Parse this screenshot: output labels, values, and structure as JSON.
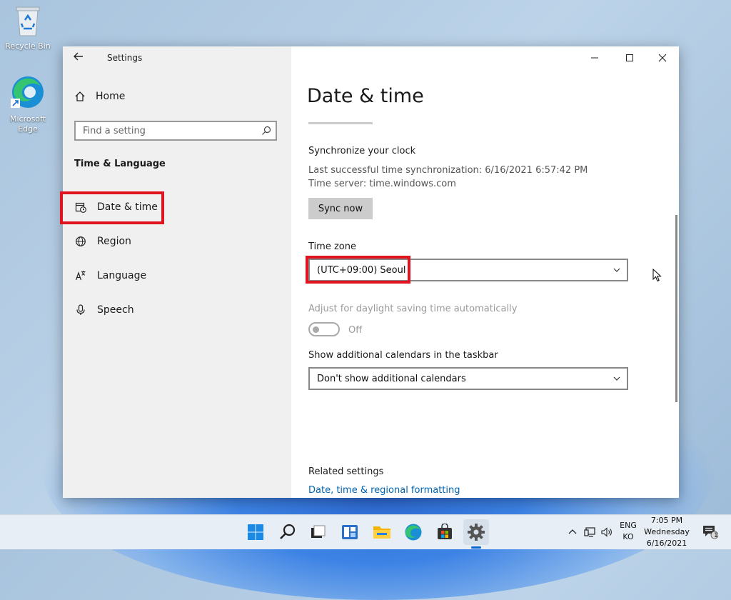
{
  "desktop": {
    "icons": [
      {
        "label": "Recycle Bin"
      },
      {
        "label": "Microsoft Edge"
      }
    ]
  },
  "window": {
    "title": "Settings",
    "controls": {
      "minimize": "minimize-icon",
      "maximize": "maximize-icon",
      "close": "close-icon"
    }
  },
  "sidebar": {
    "home": "Home",
    "search_placeholder": "Find a setting",
    "section": "Time & Language",
    "items": [
      {
        "label": "Date & time",
        "icon": "date-time-icon",
        "selected": true
      },
      {
        "label": "Region",
        "icon": "globe-icon"
      },
      {
        "label": "Language",
        "icon": "language-icon"
      },
      {
        "label": "Speech",
        "icon": "microphone-icon"
      }
    ]
  },
  "main": {
    "title": "Date & time",
    "sync": {
      "heading": "Synchronize your clock",
      "last_sync": "Last successful time synchronization: 6/16/2021 6:57:42 PM",
      "server": "Time server: time.windows.com",
      "button": "Sync now"
    },
    "timezone": {
      "label": "Time zone",
      "value": "(UTC+09:00) Seoul"
    },
    "dst": {
      "label": "Adjust for daylight saving time automatically",
      "state": "Off"
    },
    "calendars": {
      "label": "Show additional calendars in the taskbar",
      "value": "Don't show additional calendars"
    },
    "related": {
      "heading": "Related settings",
      "link": "Date, time & regional formatting"
    }
  },
  "taskbar": {
    "lang_top": "ENG",
    "lang_bottom": "KO",
    "time": "7:05 PM",
    "day": "Wednesday",
    "date": "6/16/2021",
    "notification_count": "1"
  },
  "colors": {
    "highlight": "#e0141e",
    "link": "#0063b1",
    "accent": "#0a64d0"
  }
}
